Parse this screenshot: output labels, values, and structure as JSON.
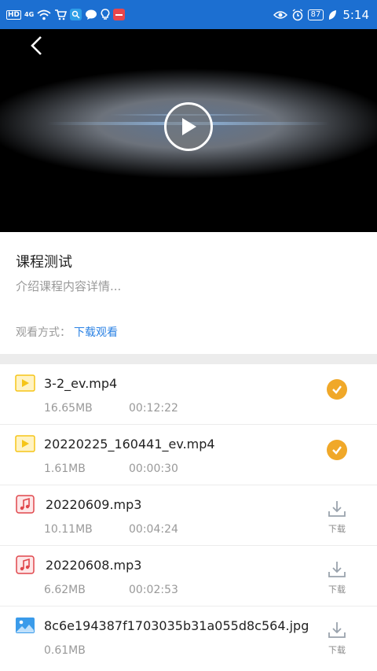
{
  "status_bar": {
    "hd": "HD",
    "network": "4G",
    "battery": "87",
    "time": "5:14"
  },
  "course": {
    "title": "课程测试",
    "description": "介绍课程内容详情...",
    "view_mode_label": "观看方式：",
    "view_mode_value": "下载观看"
  },
  "files": [
    {
      "name": "3-2_ev.mp4",
      "size": "16.65MB",
      "duration": "00:12:22",
      "type": "video-file-icon",
      "status": "downloaded"
    },
    {
      "name": "20220225_160441_ev.mp4",
      "size": "1.61MB",
      "duration": "00:00:30",
      "type": "video-file-icon",
      "status": "downloaded"
    },
    {
      "name": "20220609.mp3",
      "size": "10.11MB",
      "duration": "00:04:24",
      "type": "audio-file-icon",
      "status": "not-downloaded",
      "download_label": "下载"
    },
    {
      "name": "20220608.mp3",
      "size": "6.62MB",
      "duration": "00:02:53",
      "type": "audio-file-icon",
      "status": "not-downloaded",
      "download_label": "下载"
    },
    {
      "name": "8c6e194387f1703035b31a055d8c564.jpg",
      "size": "0.61MB",
      "duration": "",
      "type": "image-file-icon",
      "status": "not-downloaded",
      "download_label": "下载"
    }
  ],
  "colors": {
    "status_bar": "#1c6fd1",
    "accent_link": "#2b82e4",
    "downloaded_badge": "#f0a829",
    "video_icon": "#f5c518",
    "audio_icon": "#e0474c",
    "image_icon": "#3a9bea"
  }
}
